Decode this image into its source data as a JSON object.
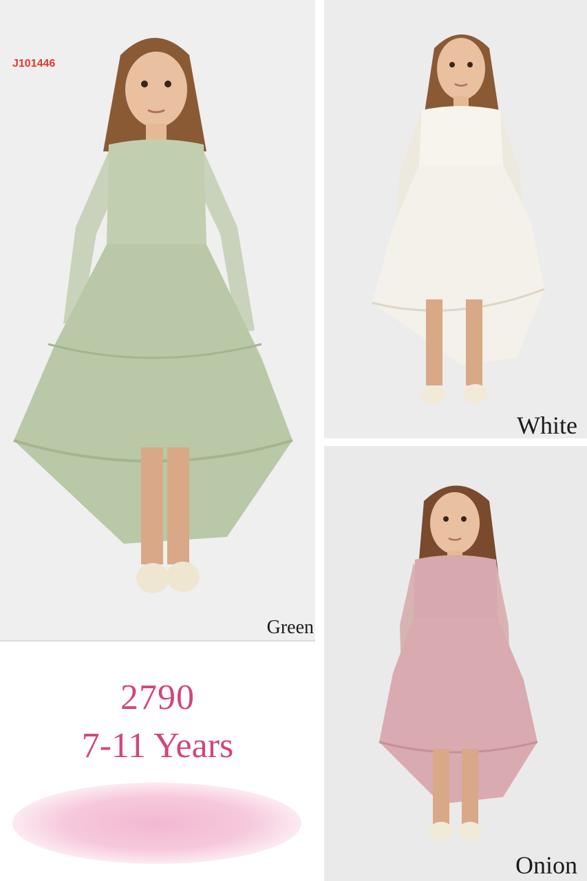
{
  "product_code": "J101446",
  "panels": {
    "green": {
      "label": "Green",
      "dress_color": "#b9c8a7"
    },
    "white": {
      "label": "White",
      "dress_color": "#f4f1ea"
    },
    "onion": {
      "label": "Onion",
      "dress_color": "#d9aab0"
    }
  },
  "price": "2790",
  "age_range": "7-11 Years",
  "accent_color": "#d2457b"
}
